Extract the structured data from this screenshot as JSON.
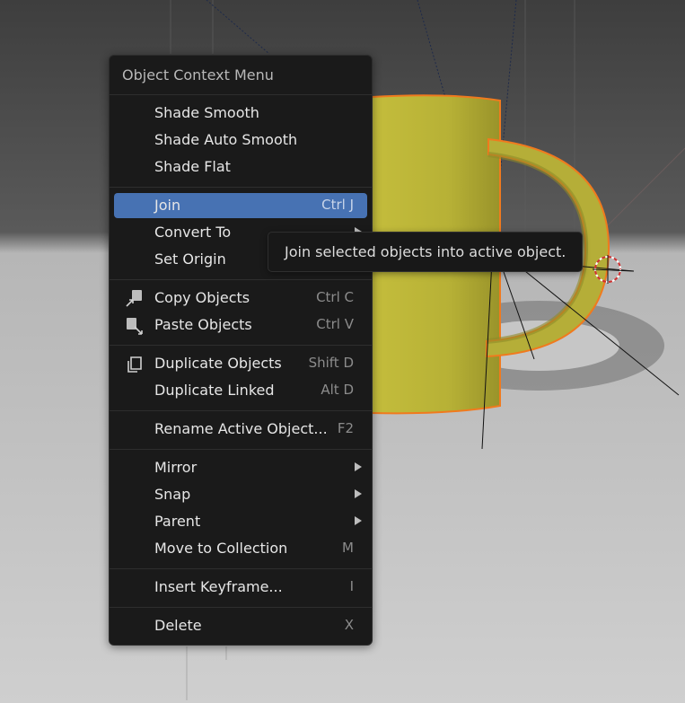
{
  "menu": {
    "title": "Object Context Menu",
    "items": [
      {
        "label": "Shade Smooth",
        "shortcut": ""
      },
      {
        "label": "Shade Auto Smooth",
        "shortcut": ""
      },
      {
        "label": "Shade Flat",
        "shortcut": ""
      },
      {
        "label": "Join",
        "shortcut": "Ctrl J"
      },
      {
        "label": "Convert To",
        "shortcut": ""
      },
      {
        "label": "Set Origin",
        "shortcut": ""
      },
      {
        "label": "Copy Objects",
        "shortcut": "Ctrl C",
        "icon": "copy-icon"
      },
      {
        "label": "Paste Objects",
        "shortcut": "Ctrl V",
        "icon": "paste-icon"
      },
      {
        "label": "Duplicate Objects",
        "shortcut": "Shift D",
        "icon": "duplicate-icon"
      },
      {
        "label": "Duplicate Linked",
        "shortcut": "Alt D"
      },
      {
        "label": "Rename Active Object...",
        "shortcut": "F2"
      },
      {
        "label": "Mirror",
        "shortcut": ""
      },
      {
        "label": "Snap",
        "shortcut": ""
      },
      {
        "label": "Parent",
        "shortcut": ""
      },
      {
        "label": "Move to Collection",
        "shortcut": "M"
      },
      {
        "label": "Insert Keyframe...",
        "shortcut": "I"
      },
      {
        "label": "Delete",
        "shortcut": "X"
      }
    ]
  },
  "tooltip": {
    "text": "Join selected objects into active object."
  },
  "colors": {
    "highlight": "#4772b3",
    "mug": "#b3ad36",
    "selection_outline": "#f07a1e",
    "menu_bg": "#1a1a1a"
  }
}
